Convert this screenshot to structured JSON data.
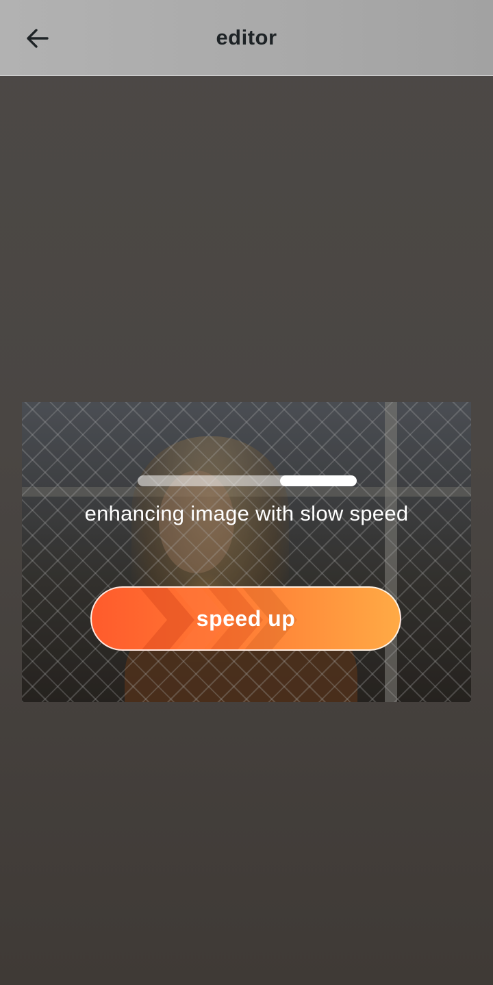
{
  "header": {
    "title": "editor",
    "back_icon": "arrow-left-icon"
  },
  "processing": {
    "status_text": "enhancing image with slow speed",
    "progress": {
      "fill_start_fraction": 0.65,
      "fill_end_fraction": 1.0
    }
  },
  "actions": {
    "speed_up_label": "speed up",
    "speed_up_icon": "chevrons-right-icon"
  },
  "colors": {
    "button_gradient_start": "#ff5b2c",
    "button_gradient_end": "#ffaa45",
    "header_background": "#adadad",
    "title_color": "#1e2326"
  }
}
